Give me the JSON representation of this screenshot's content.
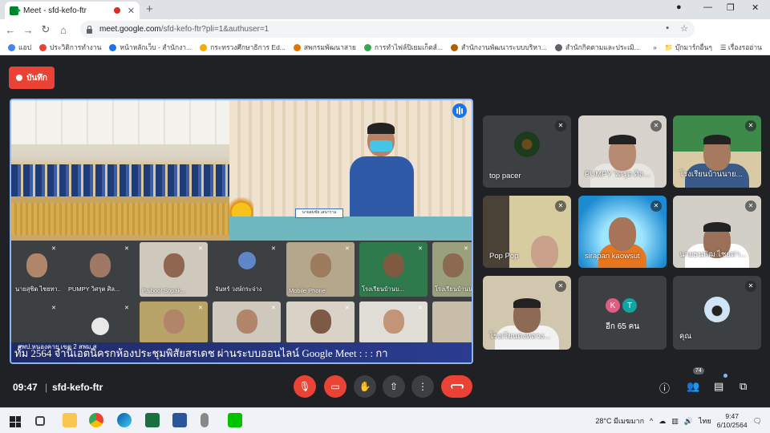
{
  "browser": {
    "tab_title": "Meet - sfd-kefo-ftr",
    "url_main": "meet.google.com",
    "url_rest": "/sfd-kefo-ftr?pli=1&authuser=1",
    "bookmarks": [
      {
        "label": "แอป",
        "color": "#4285f4"
      },
      {
        "label": "ประวิติการทำงาน",
        "color": "#ea4335"
      },
      {
        "label": "หน้าหลักเว็บ - สำนักงา...",
        "color": "#1a73e8"
      },
      {
        "label": "กระทรวงศึกษาธิการ Ed...",
        "color": "#f9ab00"
      },
      {
        "label": "สพกรมพัฒนาสาย",
        "color": "#e37400"
      },
      {
        "label": "การทำไฟล์ปิเยมเก็ตส์...",
        "color": "#34a853"
      },
      {
        "label": "สำนักงานพัฒนาระบบบริหา...",
        "color": "#b06000"
      },
      {
        "label": "สำนักกิตตามและประเมิ...",
        "color": "#5f6368"
      }
    ],
    "bookmark_more": "»",
    "bookmark_folder1": "บุ๊กมาร์กอื่นๆ",
    "bookmark_folder2": "เรื่องรออ่าน"
  },
  "meet": {
    "record_label": "บันทึก",
    "presenter_nameplate": "นายสมชัย เสนาราม",
    "ticker_top": "สพป.หนองคาย เขต 2 สพม.ส",
    "ticker": "ทั้ม 2564 จำนิเอตนิครกห้องประชุมพิสัยสรเดช ผ่านระบบออนไลน์ Google Meet : : : กา",
    "inner_tiles": [
      {
        "label": "นายสุชิต ไชยทา..."
      },
      {
        "label": "PUMPY วิศรุต ศิล..."
      },
      {
        "label": "Paibool Sopak..."
      },
      {
        "label": "จันทร์ วงษ์กระจ่าง"
      },
      {
        "label": "Mobile Phone"
      },
      {
        "label": "โรงเรียนบ้านบ..."
      },
      {
        "label": "โรงเรียนบ้านนา..."
      }
    ],
    "participants": [
      {
        "label": "top pacer"
      },
      {
        "label": "PUMPY วิศรุต ศิล..."
      },
      {
        "label": "โรงเรียนบ้านนาย..."
      },
      {
        "label": "Pop Pop"
      },
      {
        "label": "sirapan kaowsut"
      },
      {
        "label": "นายธนพัฒ ไชยค่า..."
      },
      {
        "label": "โรงเรียนดงหลวง..."
      },
      {
        "label": "อีก 65 คน"
      },
      {
        "label": "คุณ"
      }
    ],
    "more_initials": [
      "K",
      "T"
    ],
    "time": "09:47",
    "meeting_code": "sfd-kefo-ftr",
    "people_count": "74"
  },
  "taskbar": {
    "weather": "28°C มีเมฆมาก",
    "language": "ไทย",
    "time": "9:47",
    "date": "6/10/2564"
  }
}
